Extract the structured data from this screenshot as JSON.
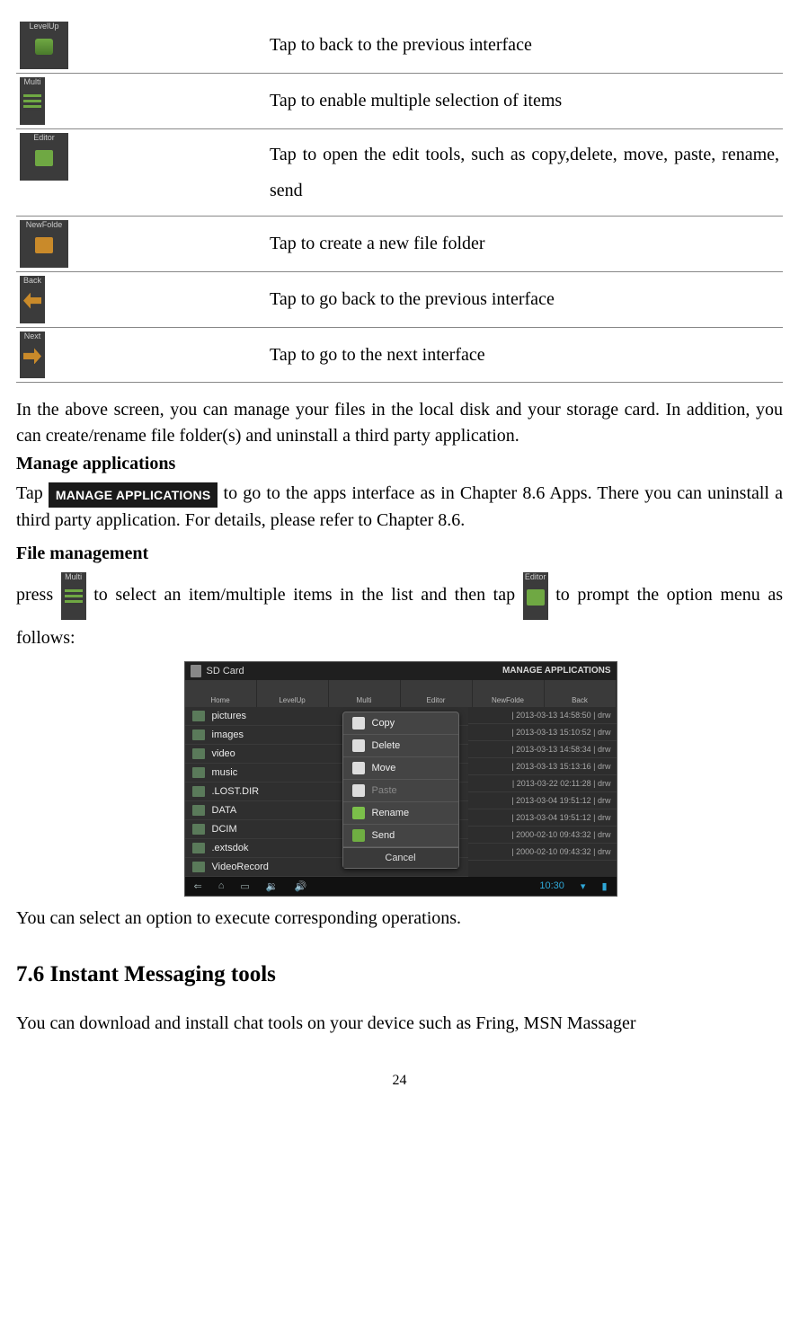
{
  "table_rows": [
    {
      "label": "LevelUp",
      "desc": "Tap to back to the previous interface",
      "small": false
    },
    {
      "label": "Multi",
      "desc": "Tap to enable multiple selection of items",
      "small": true
    },
    {
      "label": "Editor",
      "desc": "Tap to open the edit tools, such as copy,delete, move, paste, rename, send",
      "small": false
    },
    {
      "label": "NewFolde",
      "desc": "Tap to create a new file folder",
      "small": false
    },
    {
      "label": "Back",
      "desc": "Tap to go back to the previous interface",
      "small": true
    },
    {
      "label": "Next",
      "desc": "Tap to go to the next interface",
      "small": true
    }
  ],
  "para1": "In the above screen, you can manage your files in the local disk and your storage card. In addition, you can create/rename file folder(s) and uninstall a third party application.",
  "heading1": "Manage applications",
  "tap_text": "Tap ",
  "manage_btn": "MANAGE APPLICATIONS",
  "after_manage": " to go to the apps interface as in Chapter 8.6 Apps. There you can uninstall a third party application. For details, please refer to Chapter 8.6.",
  "heading2": "File management",
  "press_text": "press ",
  "mid_text": " to select an item/multiple items in the list and then tap ",
  "after_editor": " to prompt the option menu as follows:",
  "multi_label": "Multi",
  "editor_label": "Editor",
  "after_shot": "You can select an option to execute corresponding operations.",
  "section_title": "7.6 Instant Messaging tools",
  "para_last": "You can download and install chat tools on your device such as Fring, MSN Massager",
  "page_num": "24",
  "screenshot": {
    "topbar_left": "SD Card",
    "topbar_right": "MANAGE APPLICATIONS",
    "toolbar": [
      "Home",
      "LevelUp",
      "Multi",
      "Editor",
      "NewFolde",
      "Back"
    ],
    "files": [
      "pictures",
      "images",
      "video",
      "music",
      ".LOST.DIR",
      "DATA",
      "DCIM",
      ".extsdok",
      "VideoRecord"
    ],
    "meta": [
      "| 2013-03-13 14:58:50 | drw",
      "| 2013-03-13 15:10:52 | drw",
      "| 2013-03-13 14:58:34 | drw",
      "| 2013-03-13 15:13:16 | drw",
      "| 2013-03-22 02:11:28 | drw",
      "| 2013-03-04 19:51:12 | drw",
      "| 2013-03-04 19:51:12 | drw",
      "| 2000-02-10 09:43:32 | drw",
      "| 2000-02-10 09:43:32 | drw"
    ],
    "menu": [
      {
        "label": "Copy",
        "disabled": false
      },
      {
        "label": "Delete",
        "disabled": false
      },
      {
        "label": "Move",
        "disabled": false
      },
      {
        "label": "Paste",
        "disabled": true
      },
      {
        "label": "Rename",
        "disabled": false,
        "cls": "rename"
      },
      {
        "label": "Send",
        "disabled": false,
        "cls": "send"
      }
    ],
    "menu_cancel": "Cancel",
    "clock": "10:30"
  }
}
